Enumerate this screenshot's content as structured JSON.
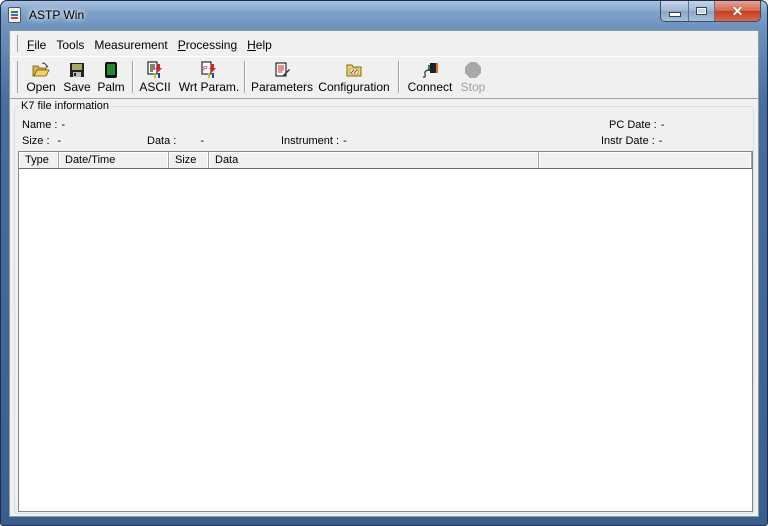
{
  "window": {
    "title": "ASTP Win",
    "controls": {
      "minimize": "minimize",
      "maximize": "maximize",
      "close": "✕"
    }
  },
  "menu": [
    {
      "label": "File",
      "accel": "F",
      "rest": "ile"
    },
    {
      "label": "Tools",
      "accel": "",
      "rest": "Tools"
    },
    {
      "label": "Measurement",
      "accel": "",
      "rest": "Measurement"
    },
    {
      "label": "Processing",
      "accel": "P",
      "rest": "rocessing"
    },
    {
      "label": "Help",
      "accel": "H",
      "rest": "elp"
    }
  ],
  "toolbar": {
    "open": {
      "label": "Open",
      "icon": "folder-open-icon"
    },
    "save": {
      "label": "Save",
      "icon": "floppy-disk-icon"
    },
    "palm": {
      "label": "Palm",
      "icon": "palm-device-icon"
    },
    "ascii": {
      "label": "ASCII",
      "icon": "ascii-export-icon"
    },
    "wrt_param": {
      "label": "Wrt Param.",
      "icon": "write-param-icon"
    },
    "parameters": {
      "label": "Parameters",
      "icon": "parameters-icon"
    },
    "configuration": {
      "label": "Configuration",
      "icon": "configuration-icon"
    },
    "connect": {
      "label": "Connect",
      "icon": "connect-plug-icon"
    },
    "stop": {
      "label": "Stop",
      "icon": "stop-icon",
      "disabled": true
    }
  },
  "file_info": {
    "group_label": "K7 file information",
    "name_label": "Name :",
    "name_value": "-",
    "size_label": "Size :",
    "size_value": "-",
    "data_label": "Data :",
    "data_value": "-",
    "instrument_label": "Instrument :",
    "instrument_value": "-",
    "pc_date_label": "PC Date :",
    "pc_date_value": "-",
    "instr_date_label": "Instr Date :",
    "instr_date_value": "-"
  },
  "table": {
    "columns": [
      "Type",
      "Date/Time",
      "Size",
      "Data",
      ""
    ],
    "rows": []
  }
}
